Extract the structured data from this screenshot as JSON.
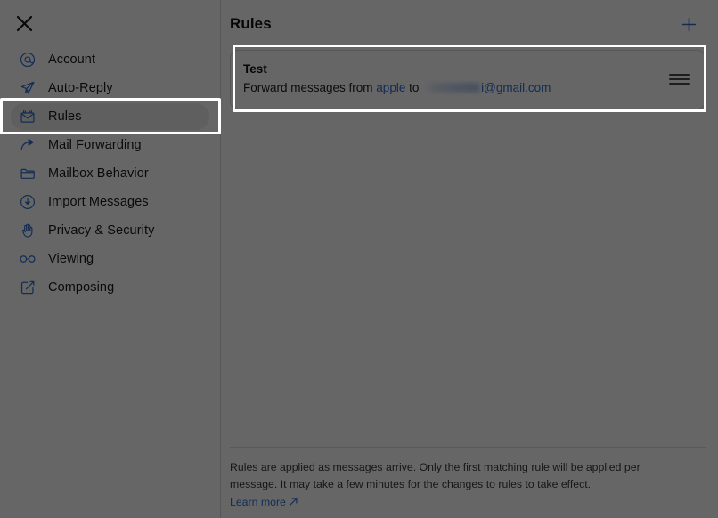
{
  "window": {
    "close_button": "close-icon"
  },
  "sidebar": {
    "items": [
      {
        "label": "Account",
        "icon": "at-sign-icon",
        "selected": false
      },
      {
        "label": "Auto-Reply",
        "icon": "paper-plane-icon",
        "selected": false
      },
      {
        "label": "Rules",
        "icon": "envelope-rules-icon",
        "selected": true
      },
      {
        "label": "Mail Forwarding",
        "icon": "forward-arrow-icon",
        "selected": false
      },
      {
        "label": "Mailbox Behavior",
        "icon": "folder-icon",
        "selected": false
      },
      {
        "label": "Import Messages",
        "icon": "download-circle-icon",
        "selected": false
      },
      {
        "label": "Privacy & Security",
        "icon": "hand-raised-icon",
        "selected": false
      },
      {
        "label": "Viewing",
        "icon": "glasses-icon",
        "selected": false
      },
      {
        "label": "Composing",
        "icon": "compose-square-icon",
        "selected": false
      }
    ]
  },
  "main": {
    "title": "Rules",
    "add_button_icon": "plus-icon",
    "rules": [
      {
        "name": "Test",
        "desc_prefix": "Forward messages from ",
        "from": "apple",
        "desc_middle": " to ",
        "to_redacted": true,
        "to_suffix": "i@gmail.com",
        "handle_icon": "drag-handle-icon"
      }
    ],
    "footer": {
      "text": "Rules are applied as messages arrive. Only the first matching rule will be applied per message. It may take a few minutes for the changes to rules to take effect. ",
      "link_label": "Learn more",
      "link_icon": "external-link-icon"
    }
  },
  "colors": {
    "accent": "#2f6fd0",
    "overlay": "#636363",
    "focus_ring": "#ffffff",
    "selected_row_bg": "#eeeeee"
  }
}
